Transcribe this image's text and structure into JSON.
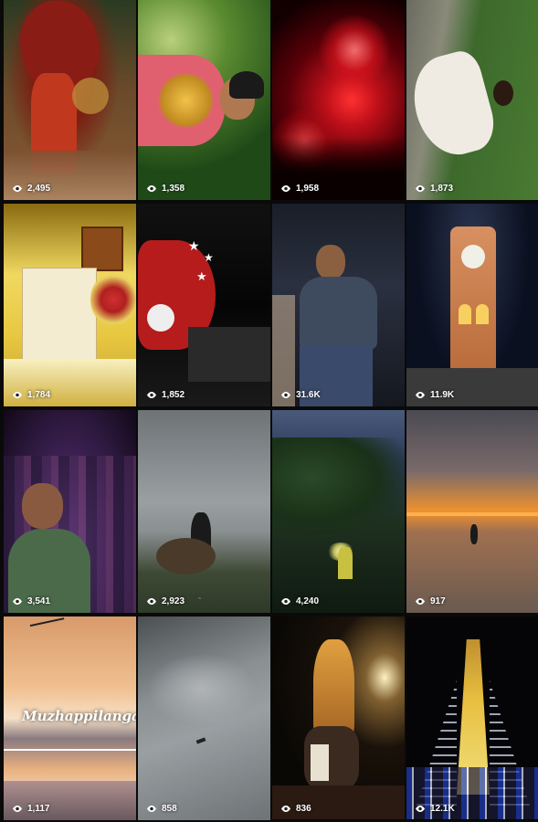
{
  "tiles": [
    {
      "id": "theyyam",
      "views": "2,495",
      "colors": [
        "#3a1d0e",
        "#b3261e",
        "#6b3a1f"
      ]
    },
    {
      "id": "bride",
      "views": "1,358",
      "colors": [
        "#1f4d19",
        "#d94a5a",
        "#4f7a2a"
      ]
    },
    {
      "id": "fireworks",
      "views": "1,958",
      "colors": [
        "#140000",
        "#e0101a",
        "#3a0005"
      ]
    },
    {
      "id": "white-dress",
      "views": "1,873",
      "colors": [
        "#3d5a2c",
        "#e8e4dc",
        "#55773a"
      ]
    },
    {
      "id": "wedding-board",
      "views": "1,784",
      "colors": [
        "#6a4c0c",
        "#f4dc6a",
        "#8e6a12"
      ]
    },
    {
      "id": "santa-stars",
      "views": "1,852",
      "colors": [
        "#050505",
        "#b71c1c",
        "#1a1a1a"
      ]
    },
    {
      "id": "drummer",
      "views": "31.6K",
      "colors": [
        "#1b1f2a",
        "#46526a",
        "#0d0f14"
      ]
    },
    {
      "id": "clock-tower",
      "views": "11.9K",
      "colors": [
        "#0b1020",
        "#c0693a",
        "#2a2f3a"
      ]
    },
    {
      "id": "dance-crowd",
      "views": "3,541",
      "colors": [
        "#1b0f2a",
        "#7a3a8a",
        "#3a2050"
      ]
    },
    {
      "id": "misty-hill",
      "views": "2,923",
      "colors": [
        "#7a7f82",
        "#a9adaf",
        "#3e4a36"
      ]
    },
    {
      "id": "night-forest",
      "views": "4,240",
      "colors": [
        "#2c3a5a",
        "#1f3020",
        "#0f1a10"
      ]
    },
    {
      "id": "sunset-beach",
      "views": "917",
      "colors": [
        "#4a4a52",
        "#f0922e",
        "#6a5a50"
      ]
    },
    {
      "id": "muzhappilangad",
      "views": "1,117",
      "colors": [
        "#e8b07a",
        "#f7e0c6",
        "#6a5a60"
      ],
      "caption": "Muzhappilangad"
    },
    {
      "id": "cloudy-sky",
      "views": "858",
      "colors": [
        "#5a5f62",
        "#9a9fa2",
        "#6e7376"
      ]
    },
    {
      "id": "elephant-festival",
      "views": "836",
      "colors": [
        "#0a0805",
        "#c08030",
        "#2a1a10"
      ]
    },
    {
      "id": "lit-chariot",
      "views": "12.1K",
      "colors": [
        "#050508",
        "#e8c040",
        "#1a1a3a"
      ]
    }
  ],
  "icons": {
    "view_count": "eye-icon"
  },
  "accent": "#ffffff"
}
